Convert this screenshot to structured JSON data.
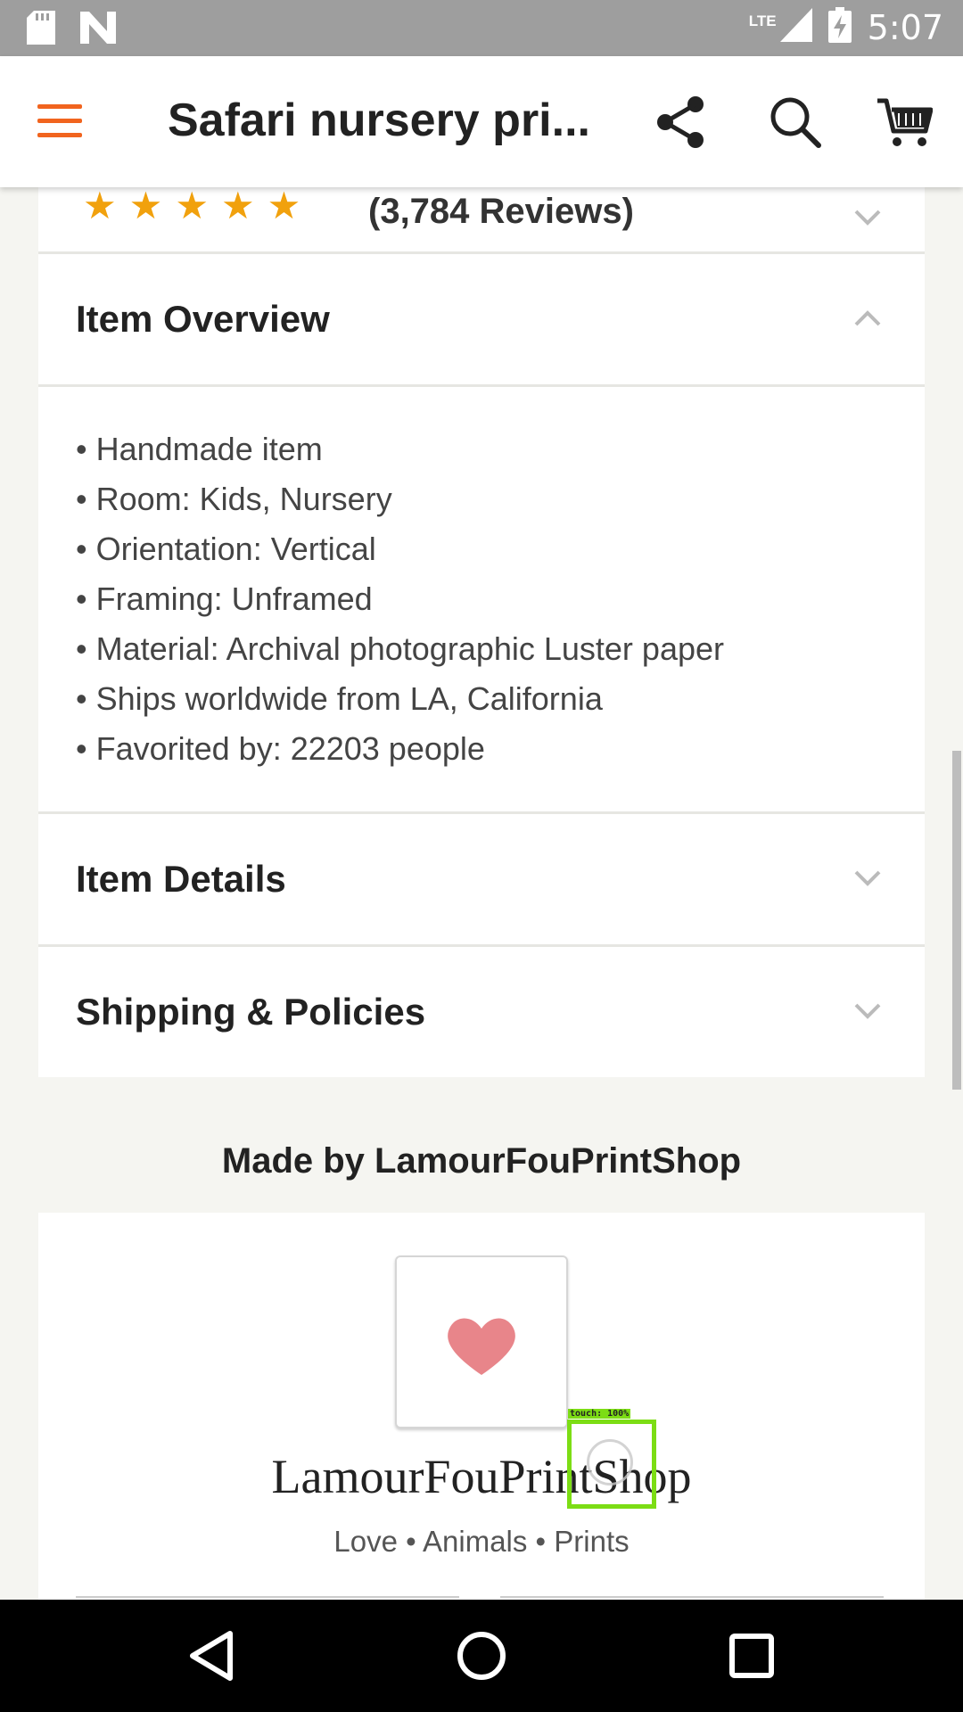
{
  "status_bar": {
    "time": "5:07",
    "network": "LTE",
    "icons": [
      "sd-card-icon",
      "n-notification-icon",
      "signal-icon",
      "battery-charging-icon"
    ]
  },
  "app_bar": {
    "title": "Safari nursery pri...",
    "icons": [
      "menu-icon",
      "share-icon",
      "search-icon",
      "cart-icon"
    ],
    "accent_color": "#f1641e"
  },
  "reviews": {
    "stars": 5,
    "count_text": "(3,784 Reviews)"
  },
  "sections": {
    "item_overview": {
      "label": "Item Overview",
      "expanded": true,
      "bullets": [
        "Handmade item",
        "Room: Kids, Nursery",
        "Orientation: Vertical",
        "Framing: Unframed",
        "Material: Archival photographic Luster paper",
        "Ships worldwide from LA, California",
        "Favorited by: 22203 people"
      ]
    },
    "item_details": {
      "label": "Item Details",
      "expanded": false
    },
    "shipping": {
      "label": "Shipping & Policies",
      "expanded": false
    }
  },
  "shop": {
    "made_by": "Made by LamourFouPrintShop",
    "name": "LamourFouPrintShop",
    "tagline": "Love • Animals • Prints",
    "avatar_icon": "heart-icon"
  },
  "touch_overlay": {
    "label": "touch: 100%"
  },
  "nav_bar": {
    "icons": [
      "back-icon",
      "home-icon",
      "recents-icon"
    ]
  }
}
